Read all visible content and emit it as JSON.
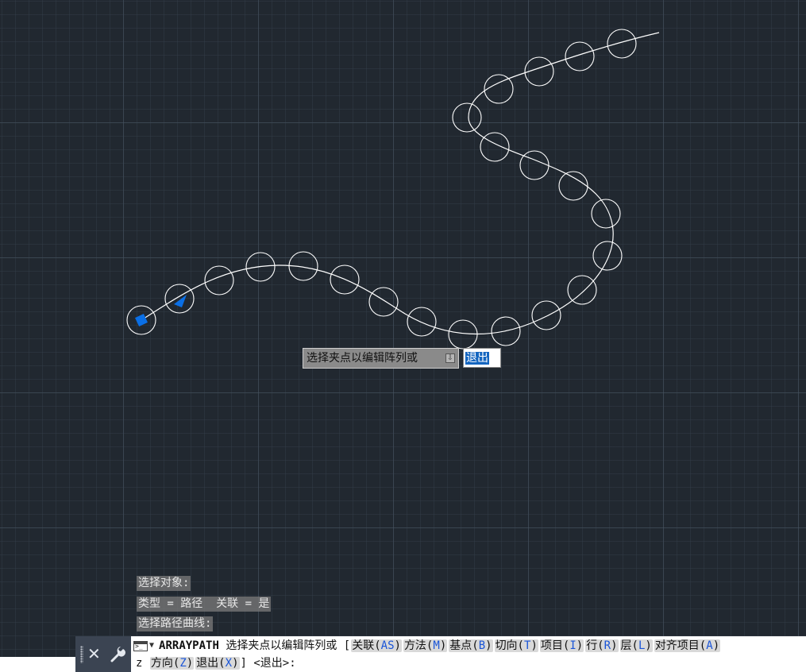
{
  "tooltip": {
    "prompt": "选择夹点以编辑阵列或",
    "icon": "down-arrow-icon",
    "input_value": "退出"
  },
  "history": [
    "选择对象:",
    "类型 = 路径  关联 = 是",
    "选择路径曲线:"
  ],
  "command": {
    "name": "ARRAYPATH",
    "prompt": "选择夹点以编辑阵列或",
    "bracket_open": "[",
    "options_line1": [
      {
        "label": "关联(",
        "key": "AS",
        "close": ")"
      },
      {
        "label": "方法(",
        "key": "M",
        "close": ")"
      },
      {
        "label": "基点(",
        "key": "B",
        "close": ")"
      },
      {
        "label": "切向(",
        "key": "T",
        "close": ")"
      },
      {
        "label": "项目(",
        "key": "I",
        "close": ")"
      },
      {
        "label": "行(",
        "key": "R",
        "close": ")"
      },
      {
        "label": "层(",
        "key": "L",
        "close": ")"
      },
      {
        "label": "对齐项目(",
        "key": "A",
        "close": ")"
      }
    ],
    "wrap_char": "z",
    "options_line2": [
      {
        "label": "方向(",
        "key": "Z",
        "close": ")"
      },
      {
        "label": "退出(",
        "key": "X",
        "close": ")"
      }
    ],
    "bracket_close": "]",
    "default": "<退出>:"
  },
  "colors": {
    "background": "#212830",
    "geometry": "#ffffff",
    "grip": "#0a6fe6",
    "command_key": "#1a55d8"
  }
}
